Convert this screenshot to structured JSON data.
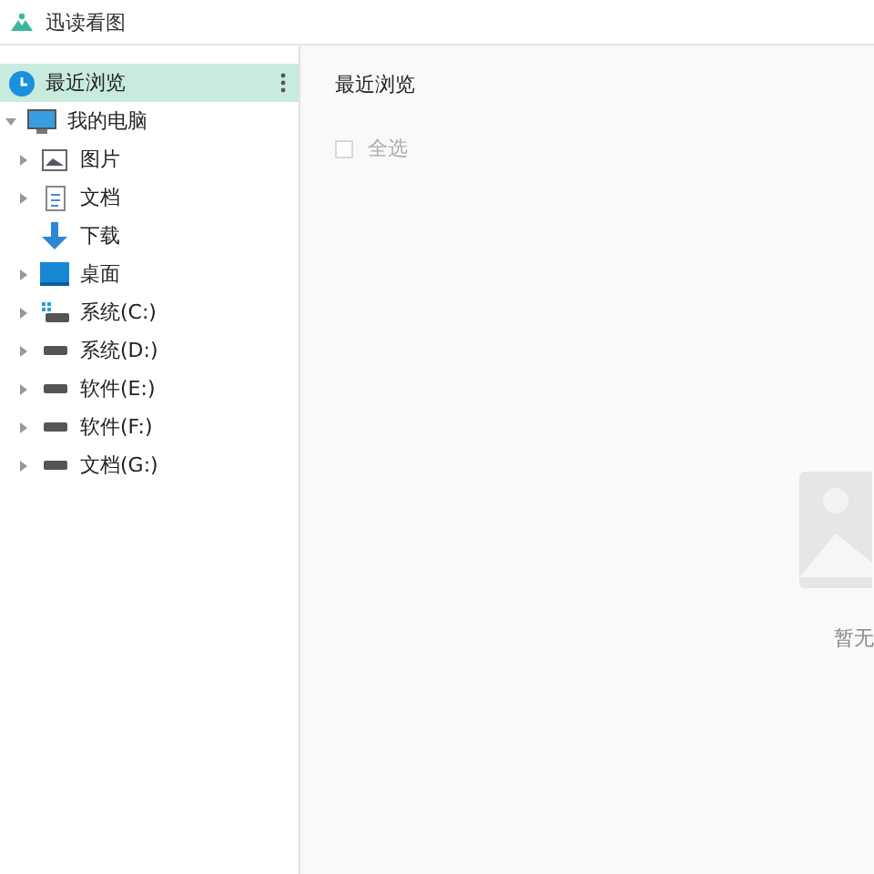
{
  "window": {
    "title": "迅读看图"
  },
  "sidebar": {
    "recent": {
      "label": "最近浏览",
      "selected": true
    },
    "computer": {
      "label": "我的电脑",
      "expanded": true,
      "children": [
        {
          "label": "图片",
          "kind": "pictures",
          "expanded": false
        },
        {
          "label": "文档",
          "kind": "documents",
          "expanded": false
        },
        {
          "label": "下载",
          "kind": "downloads"
        },
        {
          "label": "桌面",
          "kind": "desktop",
          "expanded": false
        },
        {
          "label": "系统(C:)",
          "kind": "system-drive",
          "expanded": false
        },
        {
          "label": "系统(D:)",
          "kind": "drive",
          "expanded": false
        },
        {
          "label": "软件(E:)",
          "kind": "drive",
          "expanded": false
        },
        {
          "label": "软件(F:)",
          "kind": "drive",
          "expanded": false
        },
        {
          "label": "文档(G:)",
          "kind": "drive",
          "expanded": false
        }
      ]
    }
  },
  "main": {
    "heading": "最近浏览",
    "select_all": {
      "label": "全选",
      "checked": false
    },
    "empty_text": "暂无"
  }
}
